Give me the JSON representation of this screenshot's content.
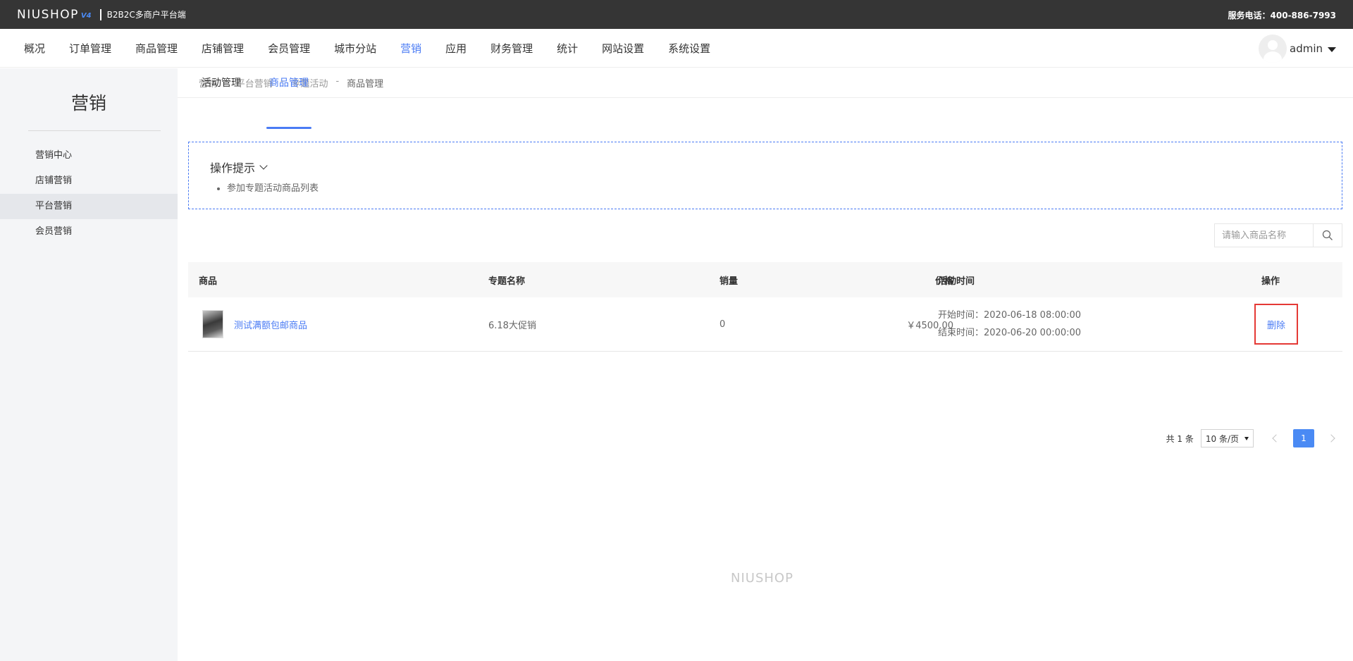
{
  "brand": {
    "logo": "NIUSHOP",
    "version": "V4",
    "subtitle": "B2B2C多商户平台端"
  },
  "hotline": "服务电话：400-886-7993",
  "nav": {
    "items": [
      {
        "label": "概况"
      },
      {
        "label": "订单管理"
      },
      {
        "label": "商品管理"
      },
      {
        "label": "店铺管理"
      },
      {
        "label": "会员管理"
      },
      {
        "label": "城市分站"
      },
      {
        "label": "营销",
        "active": true
      },
      {
        "label": "应用"
      },
      {
        "label": "财务管理"
      },
      {
        "label": "统计"
      },
      {
        "label": "网站设置"
      },
      {
        "label": "系统设置"
      }
    ],
    "user": "admin"
  },
  "sidebar": {
    "title": "营销",
    "items": [
      {
        "label": "营销中心"
      },
      {
        "label": "店铺营销"
      },
      {
        "label": "平台营销",
        "active": true
      },
      {
        "label": "会员营销"
      }
    ]
  },
  "breadcrumb": [
    "营销",
    "平台营销",
    "专题活动",
    "商品管理"
  ],
  "tabs": [
    {
      "label": "活动管理"
    },
    {
      "label": "商品管理",
      "active": true
    }
  ],
  "tips": {
    "title": "操作提示",
    "items": [
      "参加专题活动商品列表"
    ]
  },
  "search": {
    "placeholder": "请输入商品名称",
    "value": ""
  },
  "table": {
    "headers": {
      "goods": "商品",
      "topic": "专题名称",
      "sales": "销量",
      "price": "价格",
      "time": "活动时间",
      "op": "操作"
    },
    "rows": [
      {
        "goods_name": "测试满额包邮商品",
        "topic": "6.18大促销",
        "sales": "0",
        "price": "￥4500.00",
        "start": "开始时间：2020-06-18 08:00:00",
        "end": "结束时间：2020-06-20 00:00:00",
        "op": "删除"
      }
    ]
  },
  "pagination": {
    "total": "共 1 条",
    "page_size": "10 条/页",
    "current": "1"
  },
  "footer": {
    "logo": "NIUSHOP"
  },
  "colors": {
    "accent": "#4a7bf4",
    "topbar": "#353535",
    "highlight": "#e53935"
  }
}
